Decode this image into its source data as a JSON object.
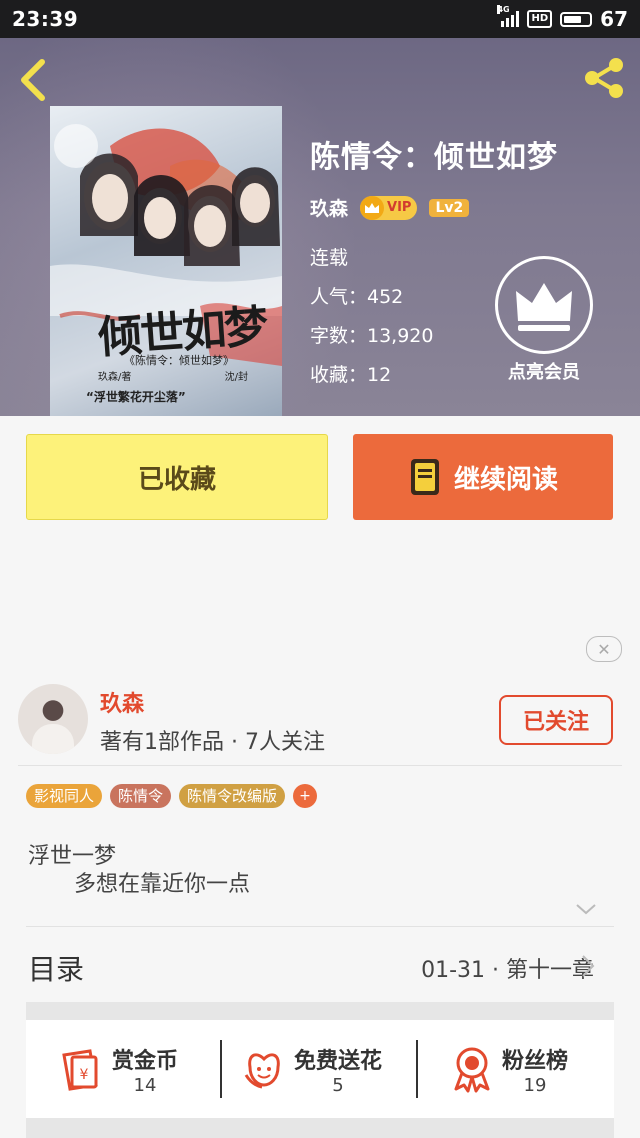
{
  "status_bar": {
    "time": "23:39",
    "network": "4G",
    "hd": "HD",
    "battery": "67"
  },
  "book": {
    "title": "陈情令：倾世如梦",
    "author": "玖森",
    "vip_label": "VIP",
    "level": "Lv2",
    "status": "连载",
    "popularity": "人气：452",
    "word_count": "字数：13,920",
    "favorites": "收藏：12",
    "member_label": "点亮会员",
    "cover": {
      "title_text": "倾世如梦",
      "subtitle": "《陈情令：倾世如梦》",
      "credit_left": "玖森/著",
      "credit_right": "沈/封",
      "quote": "“浮世繁花开尘落”"
    }
  },
  "actions": {
    "favorited_label": "已收藏",
    "continue_label": "继续阅读"
  },
  "author_card": {
    "name": "玖森",
    "desc": "著有1部作品 · 7人关注",
    "follow_label": "已关注"
  },
  "tags": [
    {
      "label": "影视同人",
      "color": "#eaa43a"
    },
    {
      "label": "陈情令",
      "color": "#c9745e"
    },
    {
      "label": "陈情令改编版",
      "color": "#d0a043"
    }
  ],
  "tag_more": "+",
  "intro": {
    "line1": "浮世一梦",
    "line2": "多想在靠近你一点"
  },
  "toc": {
    "label": "目录",
    "latest": "01-31 · 第十一章"
  },
  "stats": [
    {
      "title": "赏金币",
      "count": "14",
      "icon": "red-envelope-icon"
    },
    {
      "title": "免费送花",
      "count": "5",
      "icon": "flower-icon"
    },
    {
      "title": "粉丝榜",
      "count": "19",
      "icon": "badge-icon"
    }
  ],
  "colors": {
    "accent": "#e24a2e",
    "read_button": "#ec6a3c",
    "favorite_button": "#fdf27a"
  }
}
